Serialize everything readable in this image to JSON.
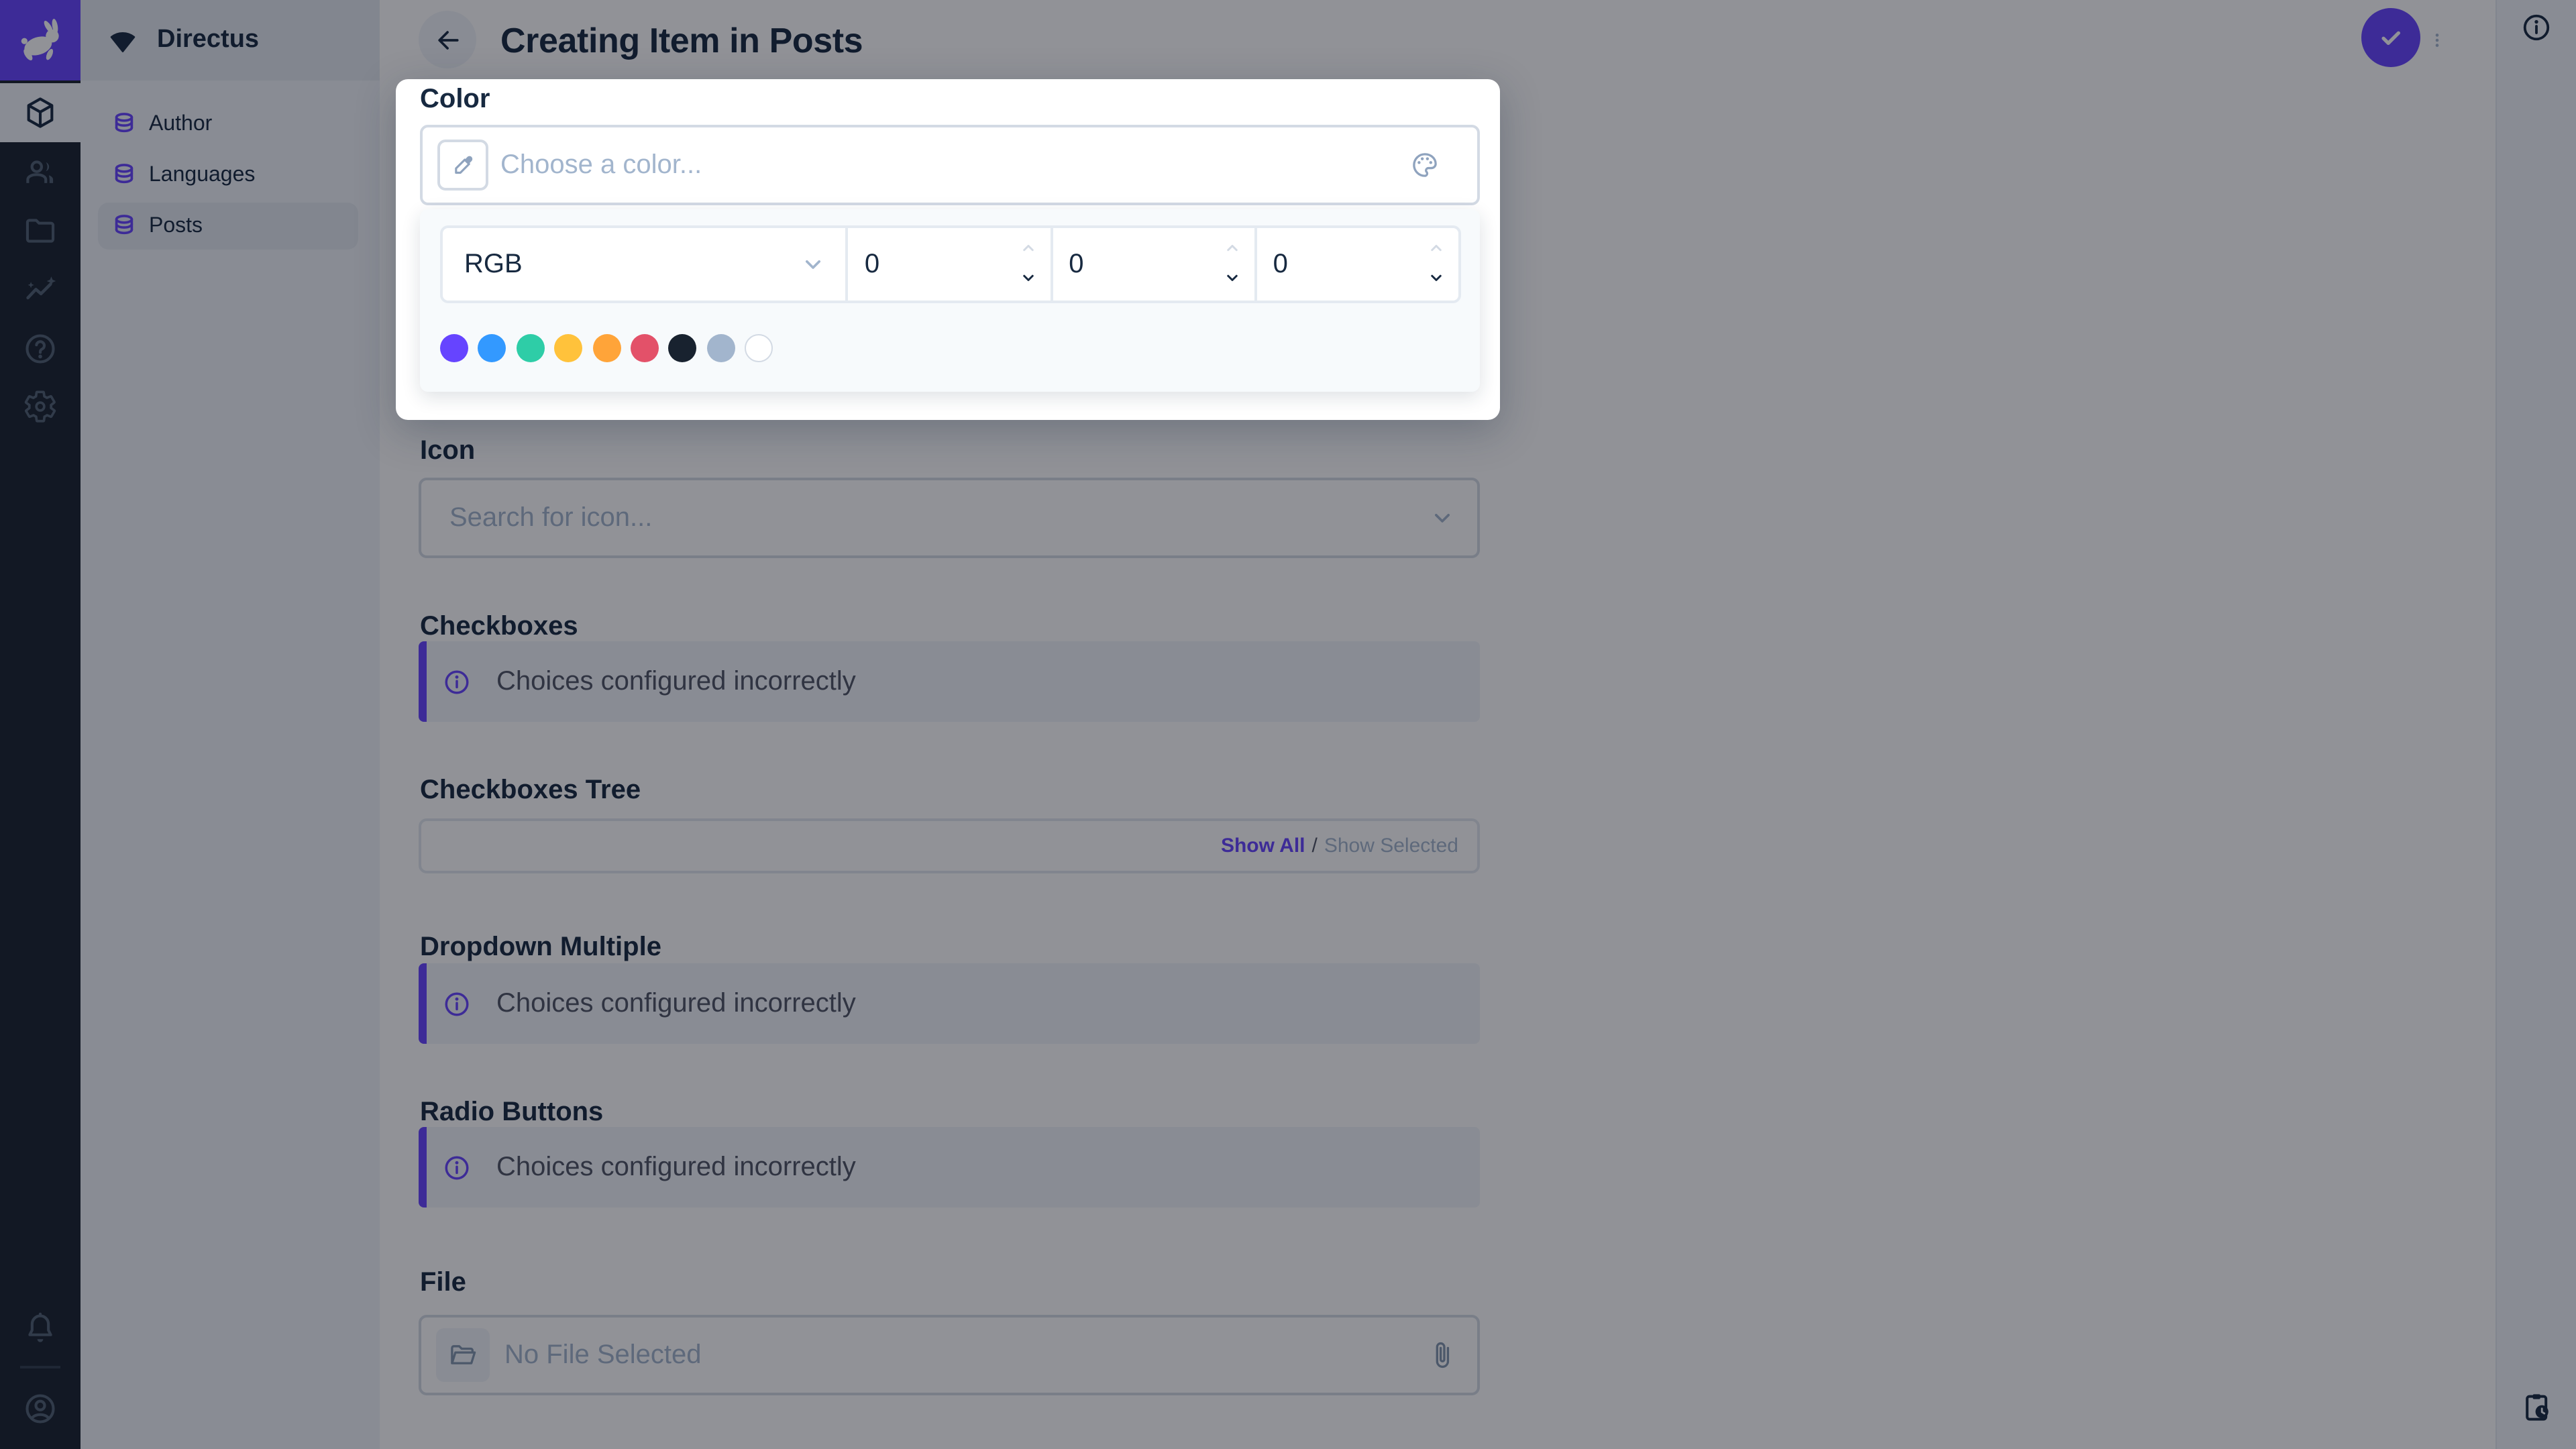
{
  "app": {
    "project_name": "Directus",
    "accent_color": "#6644FF",
    "module_bar_color": "#18222F"
  },
  "module_bar": {
    "modules": [
      {
        "name": "content",
        "icon": "cube-icon",
        "active": true
      },
      {
        "name": "user-directory",
        "icon": "people-icon",
        "active": false
      },
      {
        "name": "file-library",
        "icon": "folder-icon",
        "active": false
      },
      {
        "name": "insights",
        "icon": "insights-icon",
        "active": false
      },
      {
        "name": "help",
        "icon": "help-icon",
        "active": false
      },
      {
        "name": "settings",
        "icon": "gear-icon",
        "active": false
      }
    ],
    "bottom": [
      {
        "name": "notifications",
        "icon": "bell-icon"
      },
      {
        "name": "account",
        "icon": "avatar-icon"
      }
    ]
  },
  "navigation": {
    "items": [
      {
        "label": "Author",
        "active": false
      },
      {
        "label": "Languages",
        "active": false
      },
      {
        "label": "Posts",
        "active": true
      }
    ]
  },
  "header": {
    "title": "Creating Item in Posts"
  },
  "color_field": {
    "label": "Color",
    "placeholder": "Choose a color...",
    "mode": "RGB",
    "values": [
      "0",
      "0",
      "0"
    ],
    "swatches": [
      "#6644FF",
      "#3399FF",
      "#2ECDA7",
      "#FFC23B",
      "#FFA439",
      "#E35169",
      "#18222F",
      "#A2B5CD",
      "#FFFFFF"
    ]
  },
  "icon_field": {
    "label": "Icon",
    "placeholder": "Search for icon..."
  },
  "checkboxes_field": {
    "label": "Checkboxes",
    "notice": "Choices configured incorrectly"
  },
  "checkboxes_tree_field": {
    "label": "Checkboxes Tree",
    "show_all": "Show All",
    "separator": "/",
    "show_selected": "Show Selected"
  },
  "dropdown_multiple_field": {
    "label": "Dropdown Multiple",
    "notice": "Choices configured incorrectly"
  },
  "radio_field": {
    "label": "Radio Buttons",
    "notice": "Choices configured incorrectly"
  },
  "file_field": {
    "label": "File",
    "placeholder": "No File Selected"
  }
}
